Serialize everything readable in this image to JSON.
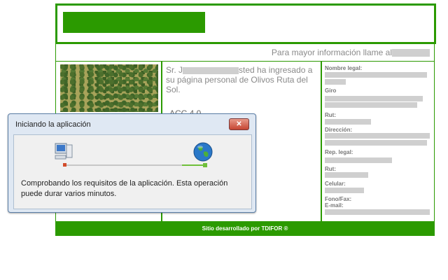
{
  "site": {
    "contact_text": "Para mayor información llame al",
    "intro_text_prefix": "Sr. J",
    "intro_text_suffix": "sted ha ingresado a su página personal de Olivos Ruta del Sol.",
    "acc_text": "ACC 4.0",
    "labels": [
      "Nombre legal:",
      "Giro",
      "Rut:",
      "Dirección:",
      "Rep. legal:",
      "Rut:",
      "Celular:",
      "Fono/Fax:",
      "E-mail:"
    ],
    "footer": "Sitio desarrollado por TDIFOR ®"
  },
  "dialog": {
    "title": "Iniciando la aplicación",
    "close_symbol": "✕",
    "message": "Comprobando los requisitos de la aplicación. Esta operación puede durar varios minutos."
  },
  "colors": {
    "brand_green": "#2b9a00",
    "dialog_bg": "#dfe8f3"
  }
}
